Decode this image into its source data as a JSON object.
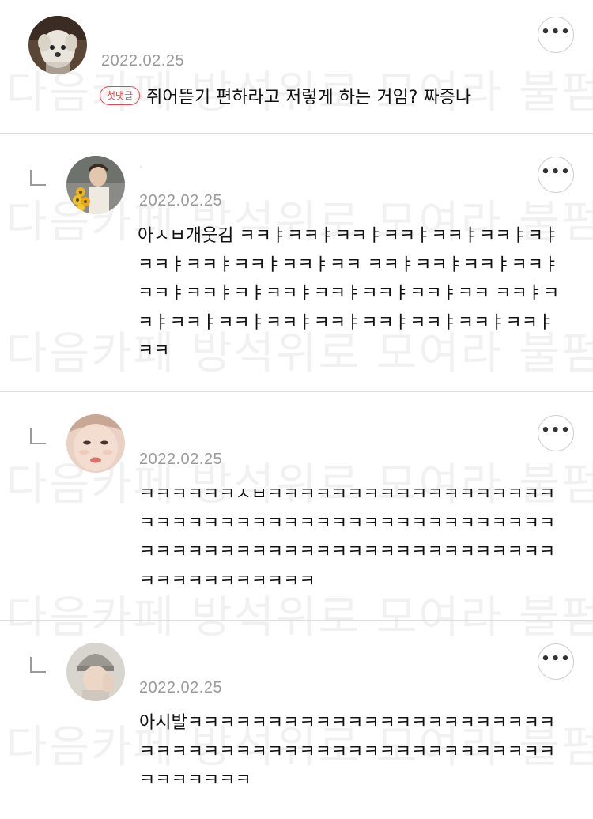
{
  "watermark": "다음카페 방석위로 모여라 불펌금지",
  "first_comment_badge": "첫댓글",
  "more_label": "•••",
  "colors": {
    "badge": "#e8444c",
    "date": "#9a9a9a",
    "divider": "#dddddd",
    "text": "#111111"
  },
  "comments": [
    {
      "username": "",
      "date": "2022.02.25",
      "text": "쥐어뜯기 편하라고 저렇게 하는 거임? 짜증나",
      "is_reply": false,
      "avatar": "puppy-photo"
    },
    {
      "username": "·",
      "date": "2022.02.25",
      "text": "아ㅅㅂ개웃김 ㅋㅋㅑㅋㅋㅑㅋㅋㅑㅋㅋㅑㅋㅋㅑㅋㅋㅑㅋㅑㅋㅋㅑㅋㅋㅑㅋㅋㅑㅋㅋㅑㅋㅋ ㅋㅋㅑㅋㅋㅑㅋㅋㅑㅋㅋㅑㅋㅋㅑㅋㅋㅑㅋㅑㅋㅋㅑㅋㅋㅑㅋㅋㅑㅋㅋㅑㅋㅋ ㅋㅋㅑㅋㅋㅑㅋㅋㅑㅋㅋㅑㅋㅋㅑㅋㅋㅑㅋㅋㅑㅋㅋㅑㅋㅋㅑㅋㅋㅑㅋㅋ",
      "is_reply": true,
      "avatar": "sunflower-person-photo"
    },
    {
      "username": "",
      "date": "2022.02.25",
      "text": "ㅋㅋㅋㅋㅋㅋㅅㅂㅋㅋㅋㅋㅋㅋㅋㅋㅋㅋㅋㅋㅋㅋㅋㅋㅋㅋㅋㅋㅋㅋㅋㅋㅋㅋㅋㅋㅋㅋㅋㅋㅋㅋㅋㅋㅋㅋㅋㅋㅋㅋㅋㅋㅋㅋㅋㅋㅋㅋㅋㅋㅋㅋㅋㅋㅋㅋㅋㅋㅋㅋㅋㅋㅋㅋㅋㅋㅋㅋㅋㅋㅋㅋㅋㅋㅋㅋㅋㅋㅋ",
      "is_reply": true,
      "avatar": "face-photo"
    },
    {
      "username": "",
      "date": "2022.02.25",
      "text": "아시발ㅋㅋㅋㅋㅋㅋㅋㅋㅋㅋㅋㅋㅋㅋㅋㅋㅋㅋㅋㅋㅋㅋㅋㅋㅋㅋㅋㅋㅋㅋㅋㅋㅋㅋㅋㅋㅋㅋㅋㅋㅋㅋㅋㅋㅋㅋㅋㅋㅋㅋㅋㅋㅋㅋㅋㅋ",
      "is_reply": true,
      "avatar": "beanie-person-photo"
    }
  ]
}
